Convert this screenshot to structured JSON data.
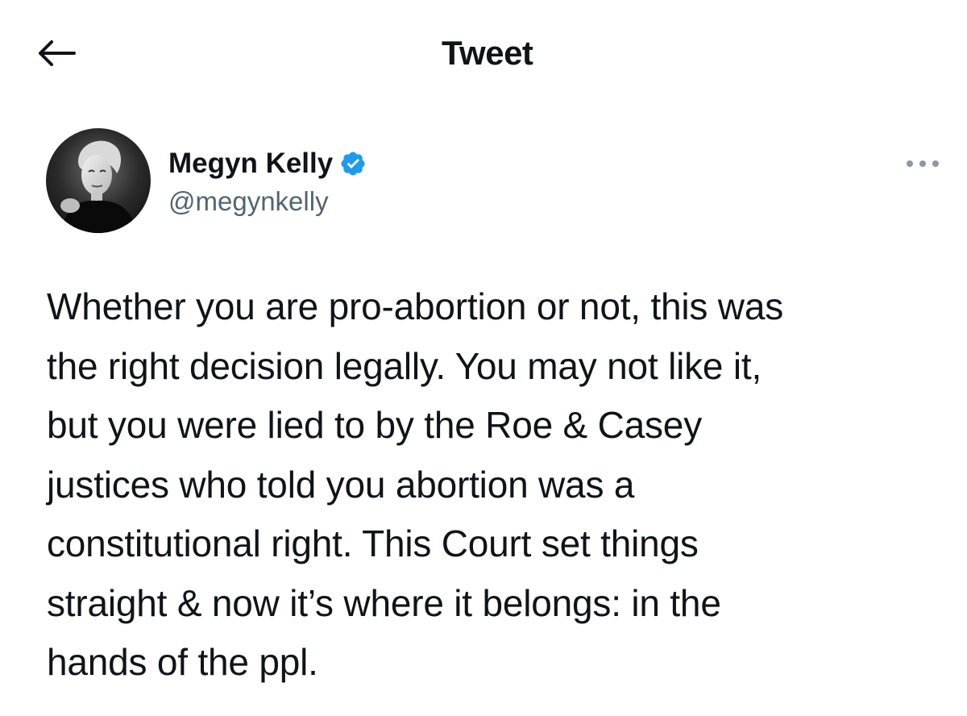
{
  "header": {
    "title": "Tweet",
    "back_icon": "arrow-left-icon"
  },
  "author": {
    "name": "Megyn Kelly",
    "handle": "@megynkelly",
    "verified": true,
    "verified_icon": "verified-badge-icon",
    "verified_color": "#1d9bf0",
    "avatar": "profile-photo"
  },
  "more_icon": "more-horizontal-icon",
  "tweet": {
    "lines": [
      "Whether you are pro-abortion or not, this was",
      "the right decision legally. You may not like it,",
      "but you were lied to by the Roe & Casey",
      "justices who told you abortion was a",
      "constitutional right. This Court set things",
      "straight & now it’s where it belongs: in the",
      "hands of the ppl."
    ]
  },
  "colors": {
    "text": "#0f1419",
    "secondary_text": "#536471",
    "background": "#ffffff"
  }
}
